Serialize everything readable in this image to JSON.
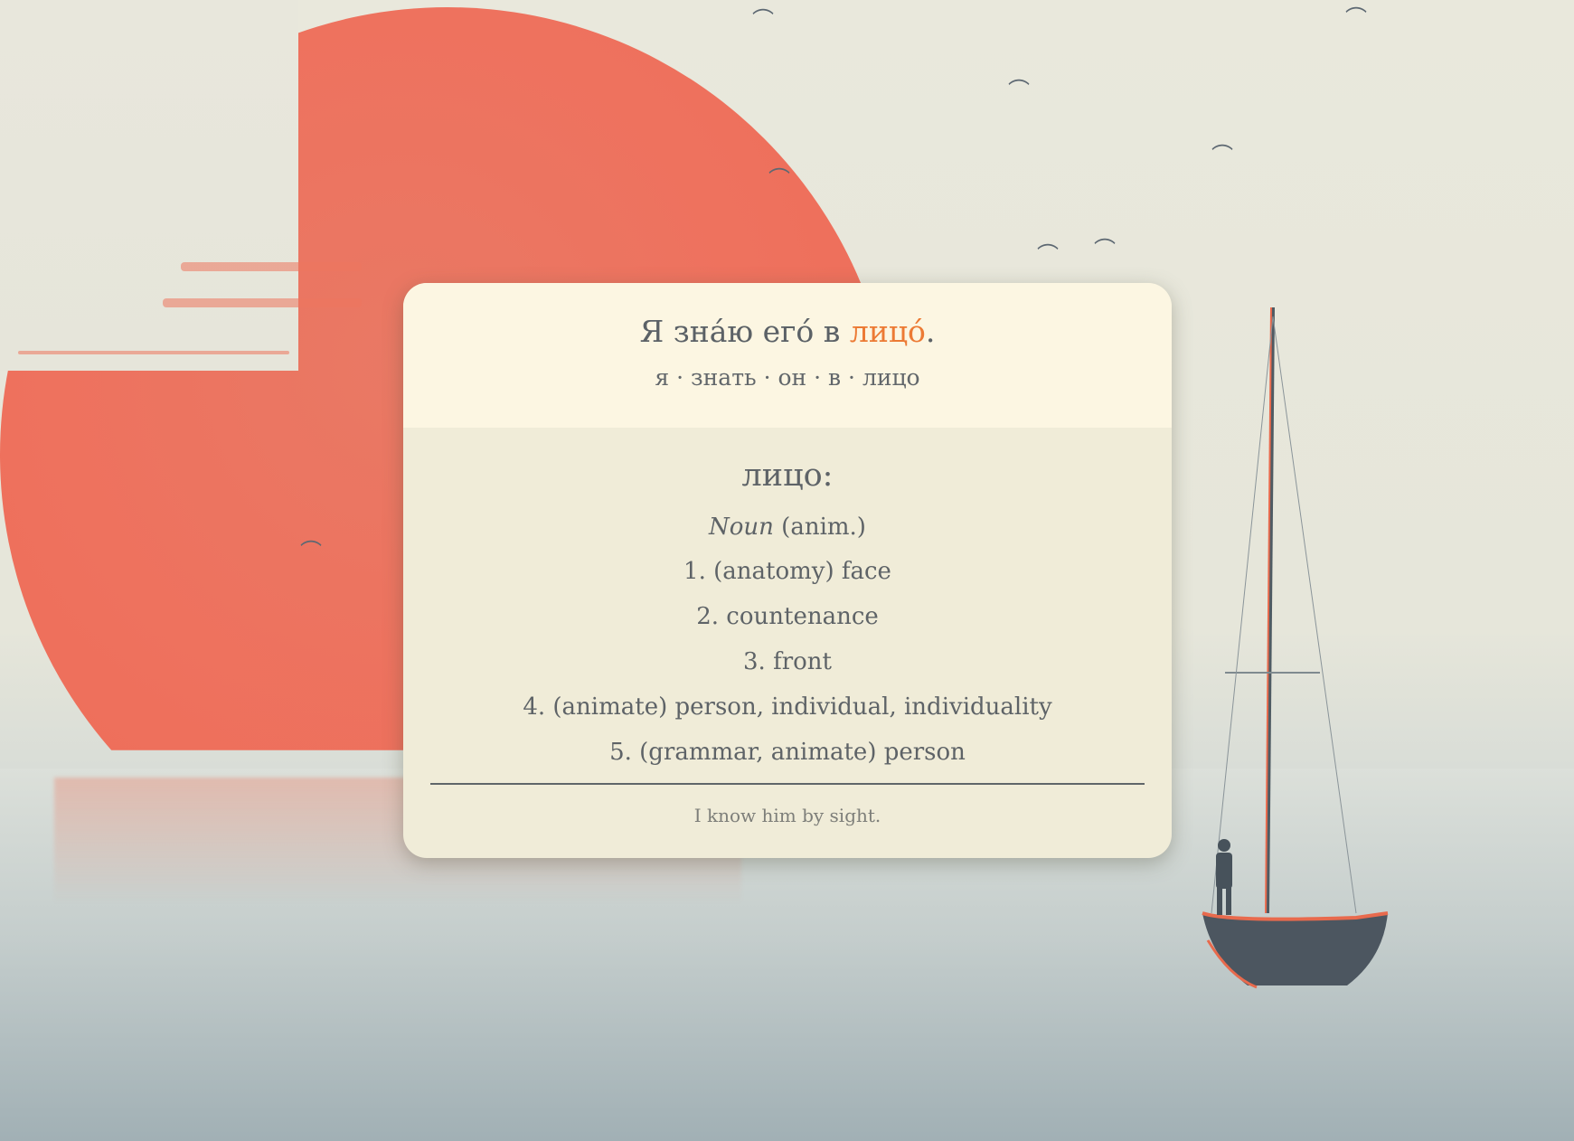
{
  "card": {
    "sentence": {
      "before": "Я зна́ю его́ в ",
      "highlight": "лицо́",
      "after": "."
    },
    "lemmas": "я · знать · он · в · лицо",
    "headword": "лицо:",
    "pos": {
      "label": "Noun",
      "note": " (anim.)"
    },
    "senses": [
      "1. (anatomy) face",
      "2. countenance",
      "3. front",
      "4. (animate) person, individual, individuality",
      "5. (grammar, animate) person"
    ],
    "translation": "I know him by sight."
  },
  "colors": {
    "highlight": "#ec7a34",
    "text": "#5e6367",
    "card_head_bg": "#fcf6e2",
    "card_body_bg": "#f0ecd8",
    "sun": "#ee6c58"
  },
  "background": {
    "icons": [
      "sun-shape",
      "bird-icon",
      "sailboat-icon",
      "person-figure-icon"
    ]
  }
}
